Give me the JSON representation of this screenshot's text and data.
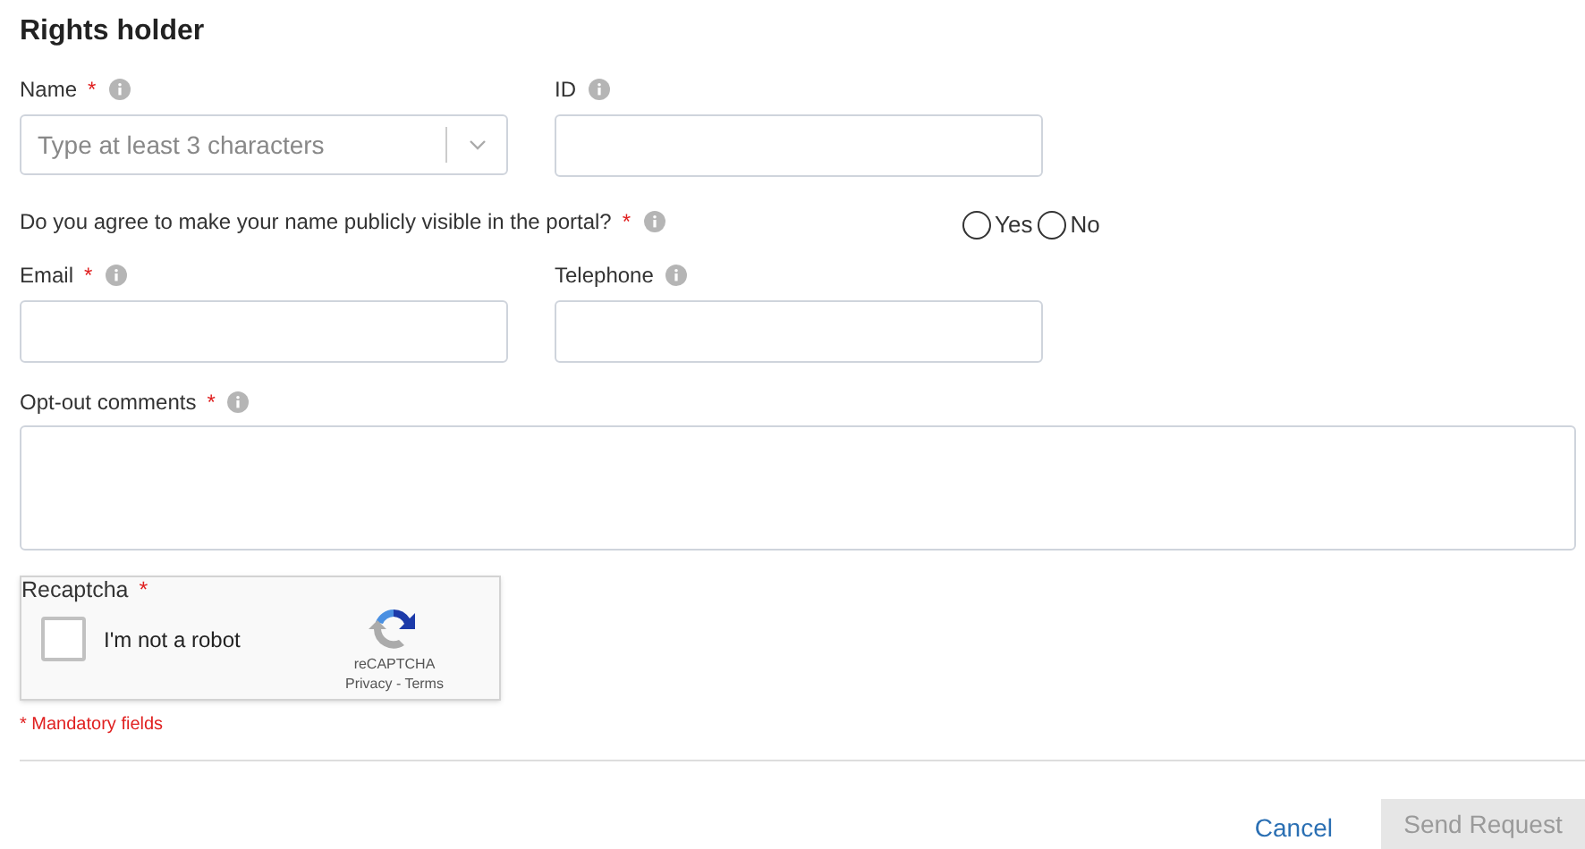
{
  "title": "Rights holder",
  "rows": [
    {
      "kind": "pair",
      "fields": [
        {
          "kind": "select",
          "label": "Name",
          "required_mark": "*",
          "placeholder": "Type at least 3 characters"
        },
        {
          "kind": "text",
          "label": "ID"
        }
      ]
    },
    {
      "kind": "question",
      "label": "Do you agree to make your name publicly visible in the portal?",
      "required_mark": "*",
      "options": [
        {
          "label": "Yes",
          "selected": false
        },
        {
          "label": "No",
          "selected": false
        }
      ]
    },
    {
      "kind": "pair",
      "fields": [
        {
          "kind": "text",
          "label": "Email",
          "required_mark": "*"
        },
        {
          "kind": "text",
          "label": "Telephone"
        }
      ]
    },
    {
      "kind": "textarea",
      "label": "Opt-out comments",
      "required_mark": "*"
    }
  ],
  "recaptcha": {
    "label": "Recaptcha",
    "required_mark": "*",
    "checkbox_label": "I'm not a robot",
    "checked": false,
    "brand": "reCAPTCHA",
    "links": "Privacy - Terms"
  },
  "mandatory_note": "* Mandatory fields",
  "buttons": [
    {
      "kind": "link",
      "label": "Cancel",
      "disabled": false
    },
    {
      "kind": "primary",
      "label": "Send Request",
      "disabled": true
    }
  ]
}
